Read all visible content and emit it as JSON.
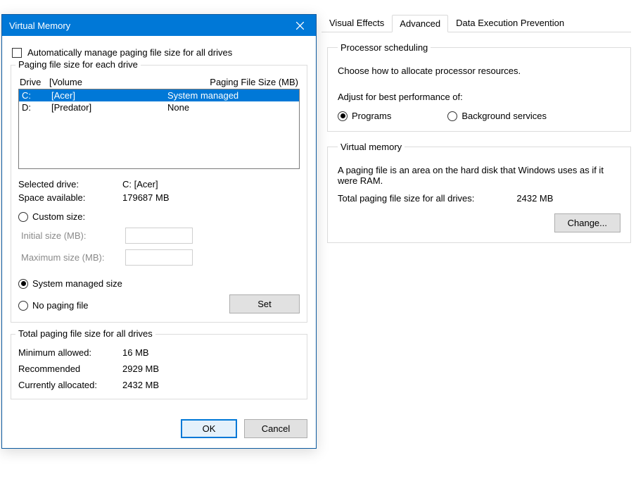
{
  "perf": {
    "tabs": {
      "visual": "Visual Effects",
      "advanced": "Advanced",
      "dep": "Data Execution Prevention"
    },
    "sched": {
      "legend": "Processor scheduling",
      "desc": "Choose how to allocate processor resources.",
      "adjust": "Adjust for best performance of:",
      "programs": "Programs",
      "background": "Background services"
    },
    "vm": {
      "legend": "Virtual memory",
      "desc": "A paging file is an area on the hard disk that Windows uses as if it were RAM.",
      "total_label": "Total paging file size for all drives:",
      "total_value": "2432 MB",
      "change": "Change..."
    }
  },
  "vm": {
    "title": "Virtual Memory",
    "auto": "Automatically manage paging file size for all drives",
    "group_drives": "Paging file size for each drive",
    "hdr_drive": "Drive",
    "hdr_volume": "[Volume",
    "hdr_size": "Paging File Size (MB)",
    "drives": [
      {
        "letter": "C:",
        "volume": "[Acer]",
        "size": "System managed",
        "selected": true
      },
      {
        "letter": "D:",
        "volume": "[Predator]",
        "size": "None",
        "selected": false
      }
    ],
    "selected_drive_label": "Selected drive:",
    "selected_drive_value": "C:  [Acer]",
    "space_label": "Space available:",
    "space_value": "179687 MB",
    "opt_custom": "Custom size:",
    "initial_label": "Initial size (MB):",
    "maximum_label": "Maximum size (MB):",
    "opt_system": "System managed size",
    "opt_none": "No paging file",
    "set": "Set",
    "group_totals": "Total paging file size for all drives",
    "min_label": "Minimum allowed:",
    "min_value": "16 MB",
    "rec_label": "Recommended",
    "rec_value": "2929 MB",
    "cur_label": "Currently allocated:",
    "cur_value": "2432 MB",
    "ok": "OK",
    "cancel": "Cancel"
  }
}
